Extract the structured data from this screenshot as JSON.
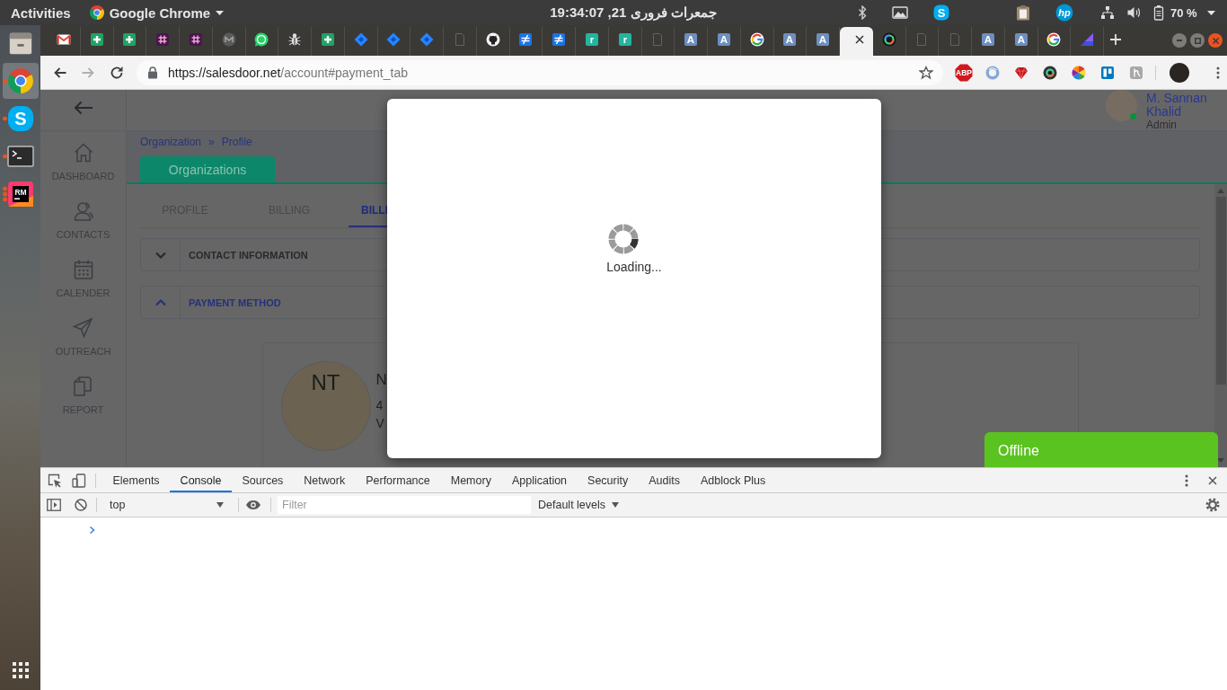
{
  "top_bar": {
    "activities": "Activities",
    "app_menu": "Google Chrome",
    "clock": "جمعرات فروری 21, 19:34:07",
    "tray": [
      {
        "kind": "bluetooth"
      },
      {
        "kind": "screen"
      },
      {
        "kind": "skype",
        "glyph": "S"
      },
      {
        "kind": "clipboard"
      },
      {
        "kind": "hp",
        "glyph": "hp"
      },
      {
        "kind": "network"
      },
      {
        "kind": "volume"
      }
    ],
    "battery": "70 %"
  },
  "dock": {
    "items": [
      {
        "kind": "files",
        "active": false,
        "running": false,
        "multiple": false
      },
      {
        "kind": "browser",
        "active": true,
        "running": true,
        "multiple": false
      },
      {
        "kind": "skype",
        "glyph": "S",
        "active": false,
        "running": true,
        "multiple": false
      },
      {
        "kind": "terminal",
        "active": false,
        "running": true,
        "multiple": false
      },
      {
        "kind": "ide",
        "glyph": "RM",
        "active": false,
        "running": true,
        "multiple": true
      }
    ]
  },
  "browser": {
    "tabs": [
      {
        "kind": "mail",
        "selected": false
      },
      {
        "kind": "plus",
        "selected": false
      },
      {
        "kind": "plus",
        "selected": false
      },
      {
        "kind": "hash",
        "selected": false
      },
      {
        "kind": "hash",
        "selected": false
      },
      {
        "kind": "gauge",
        "selected": false
      },
      {
        "kind": "chat",
        "selected": false
      },
      {
        "kind": "bug",
        "selected": false
      },
      {
        "kind": "plus",
        "selected": false
      },
      {
        "kind": "diamond",
        "selected": false
      },
      {
        "kind": "diamond",
        "selected": false
      },
      {
        "kind": "diamond",
        "selected": false
      },
      {
        "kind": "page",
        "selected": false
      },
      {
        "kind": "cat",
        "selected": false
      },
      {
        "kind": "slash",
        "selected": false
      },
      {
        "kind": "slash",
        "selected": false
      },
      {
        "kind": "letter",
        "glyph": "r",
        "color": "#22b5a0",
        "selected": false
      },
      {
        "kind": "letter",
        "glyph": "r",
        "color": "#22b5a0",
        "selected": false
      },
      {
        "kind": "page",
        "selected": false
      },
      {
        "kind": "letter",
        "glyph": "A",
        "color": "#6d8fc0",
        "selected": false
      },
      {
        "kind": "letter",
        "glyph": "A",
        "color": "#6d8fc0",
        "selected": false
      },
      {
        "kind": "g",
        "selected": false
      },
      {
        "kind": "letter",
        "glyph": "A",
        "color": "#6d8fc0",
        "selected": false
      },
      {
        "kind": "letter",
        "glyph": "A",
        "color": "#6d8fc0",
        "selected": false
      },
      {
        "selected": true
      },
      {
        "kind": "ring",
        "selected": false
      },
      {
        "kind": "page",
        "selected": false
      },
      {
        "kind": "page",
        "selected": false
      },
      {
        "kind": "letter",
        "glyph": "A",
        "color": "#6d8fc0",
        "selected": false
      },
      {
        "kind": "letter",
        "glyph": "A",
        "color": "#6d8fc0",
        "selected": false
      },
      {
        "kind": "g",
        "selected": false
      },
      {
        "kind": "triangle",
        "selected": false
      }
    ],
    "toolbar": {
      "back": {
        "disabled": false
      },
      "forward": {
        "disabled": true
      },
      "url_host": "https://salesdoor.net",
      "url_path": "/account#payment_tab",
      "extensions": [
        {
          "kind": "octagon",
          "glyph": "ABP"
        },
        {
          "kind": "ring"
        },
        {
          "kind": "gem"
        },
        {
          "kind": "lens"
        },
        {
          "kind": "wheel"
        },
        {
          "kind": "board"
        },
        {
          "kind": "tile"
        }
      ]
    }
  },
  "page": {
    "sidebar": {
      "items": [
        {
          "kind": "home",
          "label": "DASHBOARD"
        },
        {
          "kind": "contacts",
          "label": "CONTACTS"
        },
        {
          "kind": "calendar",
          "label": "CALENDER"
        },
        {
          "kind": "send",
          "label": "OUTREACH"
        },
        {
          "kind": "report",
          "label": "REPORT"
        }
      ]
    },
    "user": {
      "name": "M. Sannan Khalid",
      "role": "Admin",
      "online": true
    },
    "breadcrumb": {
      "items": [
        "Organization",
        "Profile"
      ],
      "separator": "»"
    },
    "section_tab": "Organizations",
    "tabs": [
      {
        "label": "PROFILE",
        "selected": false
      },
      {
        "label": "BILLING",
        "selected": false
      },
      {
        "label": "BILLI",
        "selected": true
      }
    ],
    "accordion": [
      {
        "title": "CONTACT INFORMATION",
        "expanded": false
      },
      {
        "title": "PAYMENT METHOD",
        "expanded": true
      }
    ],
    "card": {
      "initials": "NT",
      "title": "N",
      "details": [
        "4",
        "V"
      ]
    }
  },
  "modal": {
    "text": "Loading..."
  },
  "toast": {
    "text": "Offline"
  },
  "devtools": {
    "tabs": [
      {
        "label": "Elements",
        "selected": false
      },
      {
        "label": "Console",
        "selected": true
      },
      {
        "label": "Sources",
        "selected": false
      },
      {
        "label": "Network",
        "selected": false
      },
      {
        "label": "Performance",
        "selected": false
      },
      {
        "label": "Memory",
        "selected": false
      },
      {
        "label": "Application",
        "selected": false
      },
      {
        "label": "Security",
        "selected": false
      },
      {
        "label": "Audits",
        "selected": false
      },
      {
        "label": "Adblock Plus",
        "selected": false
      }
    ],
    "context": "top",
    "filter": {
      "placeholder": "Filter"
    },
    "levels": "Default levels"
  }
}
